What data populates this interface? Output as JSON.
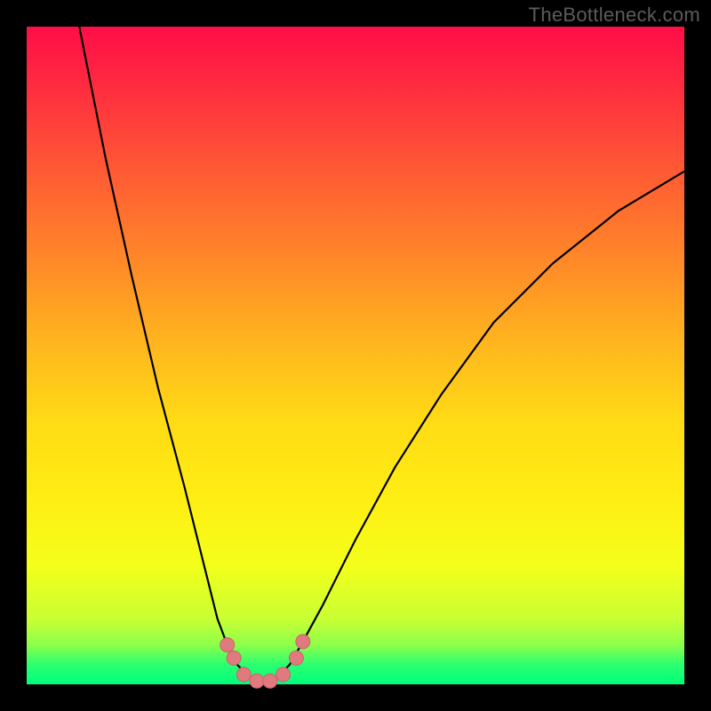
{
  "watermark": "TheBottleneck.com",
  "chart_data": {
    "type": "line",
    "title": "",
    "xlabel": "",
    "ylabel": "",
    "xlim": [
      0,
      100
    ],
    "ylim": [
      0,
      100
    ],
    "grid": false,
    "series": [
      {
        "name": "curve",
        "color": "#000000",
        "points": [
          {
            "x": 8,
            "y": 100
          },
          {
            "x": 12,
            "y": 80
          },
          {
            "x": 16,
            "y": 62
          },
          {
            "x": 20,
            "y": 45
          },
          {
            "x": 24,
            "y": 30
          },
          {
            "x": 27,
            "y": 18
          },
          {
            "x": 29,
            "y": 10
          },
          {
            "x": 30.5,
            "y": 6
          },
          {
            "x": 32,
            "y": 3
          },
          {
            "x": 34,
            "y": 1
          },
          {
            "x": 36,
            "y": 0.5
          },
          {
            "x": 38,
            "y": 1
          },
          {
            "x": 40,
            "y": 3
          },
          {
            "x": 42,
            "y": 6.5
          },
          {
            "x": 45,
            "y": 12
          },
          {
            "x": 50,
            "y": 22
          },
          {
            "x": 56,
            "y": 33
          },
          {
            "x": 63,
            "y": 44
          },
          {
            "x": 71,
            "y": 55
          },
          {
            "x": 80,
            "y": 64
          },
          {
            "x": 90,
            "y": 72
          },
          {
            "x": 100,
            "y": 78
          }
        ]
      }
    ],
    "markers": {
      "name": "highlight-points",
      "color": "#e07a7e",
      "points": [
        {
          "x": 30.5,
          "y": 6
        },
        {
          "x": 31.5,
          "y": 4
        },
        {
          "x": 33,
          "y": 1.5
        },
        {
          "x": 35,
          "y": 0.5
        },
        {
          "x": 37,
          "y": 0.5
        },
        {
          "x": 39,
          "y": 1.5
        },
        {
          "x": 41,
          "y": 4
        },
        {
          "x": 42,
          "y": 6.5
        }
      ]
    },
    "background_gradient": {
      "direction": "top-to-bottom",
      "stops": [
        {
          "pos": 0,
          "color": "#ff0d47"
        },
        {
          "pos": 50,
          "color": "#ffd018"
        },
        {
          "pos": 100,
          "color": "#00ff7b"
        }
      ]
    }
  }
}
